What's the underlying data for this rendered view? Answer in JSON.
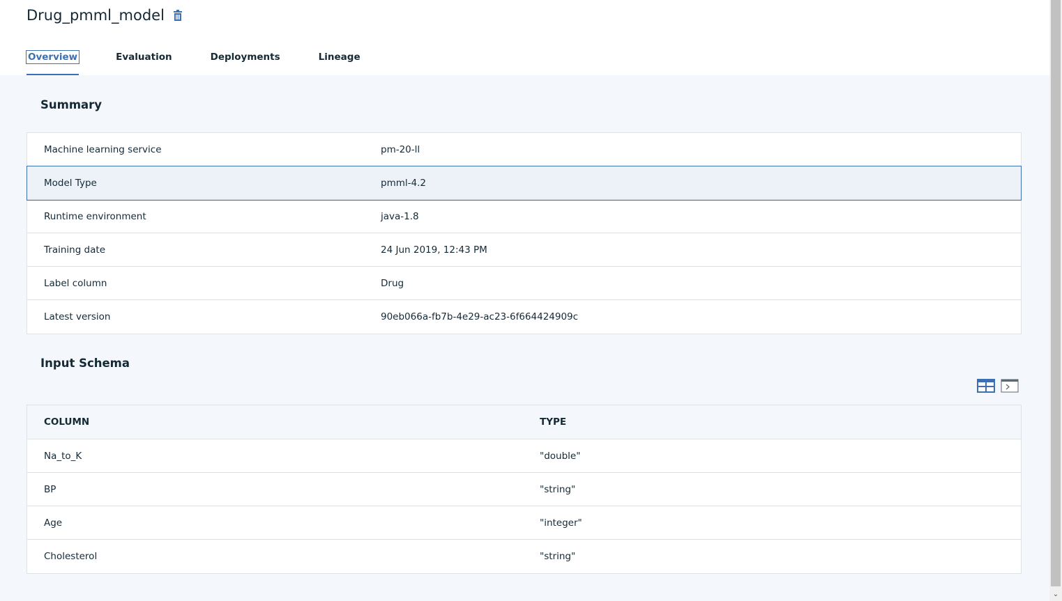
{
  "header": {
    "title": "Drug_pmml_model",
    "delete_icon": "trash-icon",
    "tabs": [
      {
        "label": "Overview",
        "active": true
      },
      {
        "label": "Evaluation"
      },
      {
        "label": "Deployments"
      },
      {
        "label": "Lineage"
      }
    ]
  },
  "summary": {
    "title": "Summary",
    "rows": [
      {
        "key": "Machine learning service",
        "value": "pm-20-ll"
      },
      {
        "key": "Model Type",
        "value": "pmml-4.2"
      },
      {
        "key": "Runtime environment",
        "value": "java-1.8"
      },
      {
        "key": "Training date",
        "value": "24 Jun 2019, 12:43 PM"
      },
      {
        "key": "Label column",
        "value": "Drug"
      },
      {
        "key": "Latest version",
        "value": "90eb066a-fb7b-4e29-ac23-6f664424909c"
      }
    ]
  },
  "schema": {
    "title": "Input Schema",
    "view_icons": [
      "table-view-icon",
      "code-view-icon"
    ],
    "columns": [
      "COLUMN",
      "TYPE"
    ],
    "rows": [
      {
        "column": "Na_to_K",
        "type": "\"double\""
      },
      {
        "column": "BP",
        "type": "\"string\""
      },
      {
        "column": "Age",
        "type": "\"integer\""
      },
      {
        "column": "Cholesterol",
        "type": "\"string\""
      }
    ]
  },
  "colors": {
    "accent": "#3d70b2",
    "text": "#152935",
    "background": "#f4f7fb",
    "border": "#dfe3e6"
  }
}
